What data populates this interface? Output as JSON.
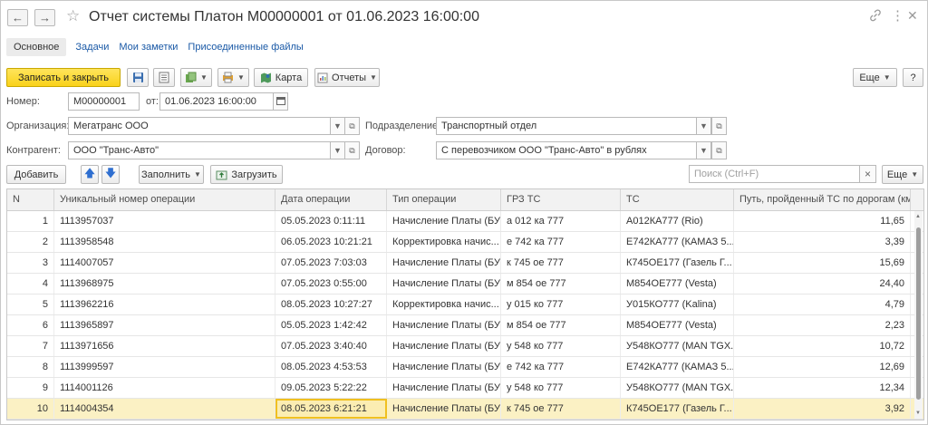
{
  "window": {
    "title": "Отчет системы Платон М00000001 от 01.06.2023 16:00:00"
  },
  "tabs": [
    {
      "label": "Основное"
    },
    {
      "label": "Задачи"
    },
    {
      "label": "Мои заметки"
    },
    {
      "label": "Присоединенные файлы"
    }
  ],
  "toolbar": {
    "save_close": "Записать и закрыть",
    "map": "Карта",
    "reports": "Отчеты",
    "more": "Еще",
    "help": "?"
  },
  "form": {
    "number_label": "Номер:",
    "number_value": "М00000001",
    "date_label": "от:",
    "date_value": "01.06.2023 16:00:00",
    "org_label": "Организация:",
    "org_value": "Мегатранс ООО",
    "division_label": "Подразделение:",
    "division_value": "Транспортный отдел",
    "contractor_label": "Контрагент:",
    "contractor_value": "ООО \"Транс-Авто\"",
    "contract_label": "Договор:",
    "contract_value": "С перевозчиком ООО \"Транс-Авто\" в рублях"
  },
  "table_toolbar": {
    "add": "Добавить",
    "fill": "Заполнить",
    "load": "Загрузить",
    "search_placeholder": "Поиск (Ctrl+F)",
    "clear": "×",
    "more": "Еще"
  },
  "table": {
    "columns": [
      "N",
      "Уникальный номер операции",
      "Дата операции",
      "Тип операции",
      "ГРЗ ТС",
      "ТС",
      "Путь, пройденный ТС по дорогам (км)"
    ],
    "rows": [
      [
        "1",
        "1113957037",
        "05.05.2023 0:11:11",
        "Начисление Платы (БУ)",
        "а 012 ка 777",
        "А012КА777 (Rio)",
        "11,65"
      ],
      [
        "2",
        "1113958548",
        "06.05.2023 10:21:21",
        "Корректировка начис...",
        "е 742 ка 777",
        "Е742КА777 (КАМАЗ 5...",
        "3,39"
      ],
      [
        "3",
        "1114007057",
        "07.05.2023 7:03:03",
        "Начисление Платы (БУ)",
        "к 745 ое 777",
        "К745ОЕ177 (Газель Г...",
        "15,69"
      ],
      [
        "4",
        "1113968975",
        "07.05.2023 0:55:00",
        "Начисление Платы (БУ)",
        "м 854 ое 777",
        "М854ОЕ777 (Vesta)",
        "24,40"
      ],
      [
        "5",
        "1113962216",
        "08.05.2023 10:27:27",
        "Корректировка начис...",
        "у 015 ко 777",
        "У015КО777 (Kalina)",
        "4,79"
      ],
      [
        "6",
        "1113965897",
        "05.05.2023 1:42:42",
        "Начисление Платы (БУ)",
        "м 854 ое 777",
        "М854ОЕ777 (Vesta)",
        "2,23"
      ],
      [
        "7",
        "1113971656",
        "07.05.2023 3:40:40",
        "Начисление Платы (БУ)",
        "у 548 ко 777",
        "У548КО777 (MAN TGX...",
        "10,72"
      ],
      [
        "8",
        "1113999597",
        "08.05.2023 4:53:53",
        "Начисление Платы (БУ)",
        "е 742 ка 777",
        "Е742КА777 (КАМАЗ 5...",
        "12,69"
      ],
      [
        "9",
        "1114001126",
        "09.05.2023 5:22:22",
        "Начисление Платы (БУ)",
        "у 548 ко 777",
        "У548КО777 (MAN TGX...",
        "12,34"
      ],
      [
        "10",
        "1114004354",
        "08.05.2023 6:21:21",
        "Начисление Платы (БУ)",
        "к 745 ое 777",
        "К745ОЕ177 (Газель Г...",
        "3,92"
      ]
    ],
    "selected_row": 10
  },
  "colors": {
    "accent_yellow": "#f9d21a",
    "link_blue": "#1a59a6",
    "selected_row": "#fbf1c4"
  }
}
